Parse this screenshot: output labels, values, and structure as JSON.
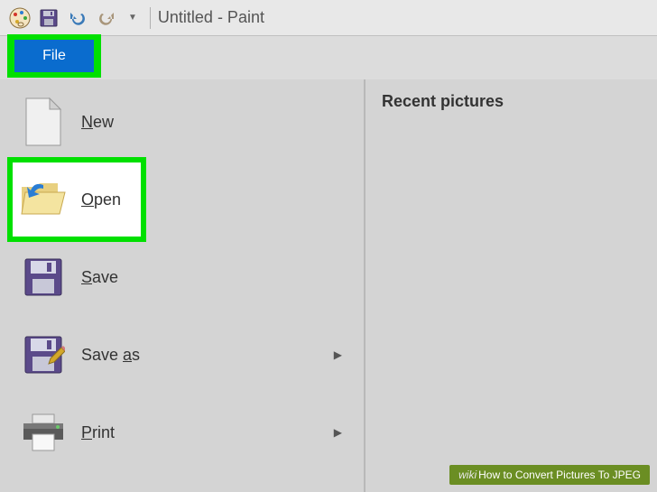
{
  "titlebar": {
    "title": "Untitled - Paint"
  },
  "tabs": {
    "file": "File"
  },
  "menu": {
    "new": "New",
    "open": "Open",
    "save": "Save",
    "save_as": "Save as",
    "print": "Print"
  },
  "right": {
    "title": "Recent pictures"
  },
  "watermark": {
    "brand": "wiki",
    "text": "How to Convert Pictures To JPEG"
  }
}
